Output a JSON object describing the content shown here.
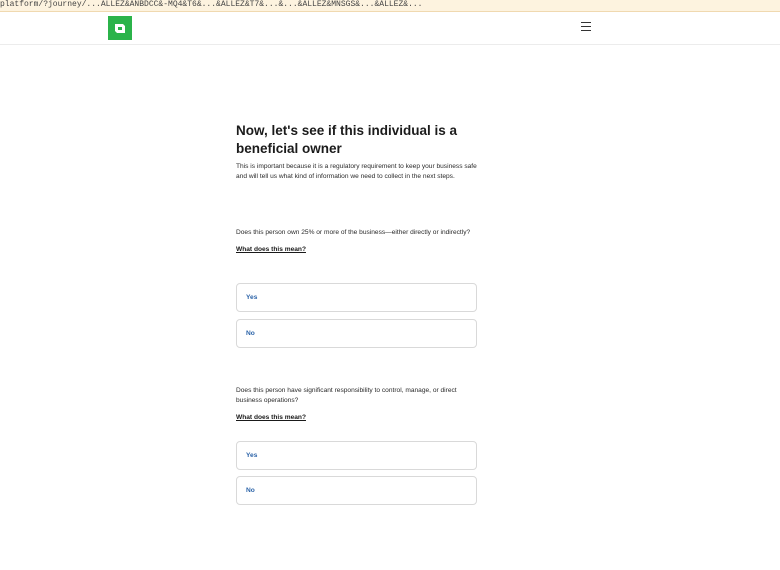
{
  "browser": {
    "url_fragment": "platform/?journey/...ALLEZ&ANBDCC&-MQ4&T6&...&ALLEZ&T7&...&...&ALLEZ&MNSGS&...&ALLEZ&..."
  },
  "header": {
    "logo_letter": "a",
    "logo_color": "#2bb34a",
    "menu_icon": "hamburger-menu-icon"
  },
  "main": {
    "title": "Now, let's see if this individual is a beneficial owner",
    "intro": "This is important because it is a regulatory requirement to keep your business safe and will tell us what kind of information we need to collect in the next steps.",
    "questions": [
      {
        "text": "Does this person own 25% or more of the business—either directly or indirectly?",
        "help_link": "What does this mean?",
        "options": [
          "Yes",
          "No"
        ]
      },
      {
        "text": "Does this person have significant responsibility to control, manage, or direct business operations?",
        "help_link": "What does this mean?",
        "options": [
          "Yes",
          "No"
        ]
      }
    ]
  },
  "colors": {
    "accent": "#2bb34a",
    "option_text": "#2b63a8",
    "border": "#d9d9d9"
  }
}
